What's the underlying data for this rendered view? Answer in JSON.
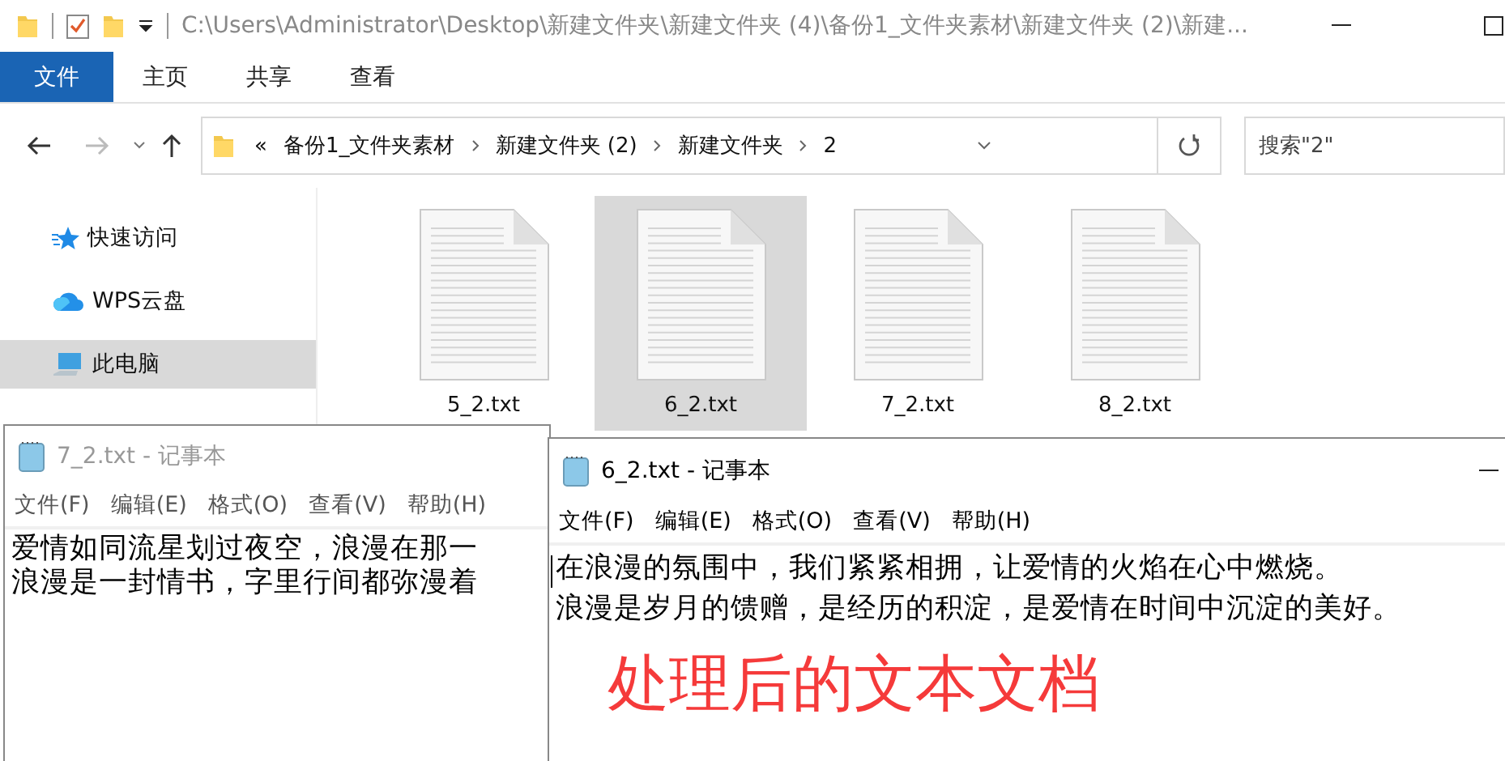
{
  "explorer": {
    "title_path": "C:\\Users\\Administrator\\Desktop\\新建文件夹\\新建文件夹 (4)\\备份1_文件夹素材\\新建文件夹 (2)\\新建...",
    "ribbon_tabs": [
      {
        "label": "文件",
        "selected": true
      },
      {
        "label": "主页",
        "selected": false
      },
      {
        "label": "共享",
        "selected": false
      },
      {
        "label": "查看",
        "selected": false
      }
    ],
    "breadcrumb": {
      "overflow": "«",
      "parts": [
        "备份1_文件夹素材",
        "新建文件夹 (2)",
        "新建文件夹",
        "2"
      ]
    },
    "search": {
      "placeholder": "搜索\"2\""
    },
    "sidebar": {
      "items": [
        {
          "kind": "star",
          "label": "快速访问",
          "selected": false
        },
        {
          "kind": "cloud",
          "label": "WPS云盘",
          "selected": false
        },
        {
          "kind": "pc",
          "label": "此电脑",
          "selected": true
        }
      ]
    },
    "files": [
      {
        "name": "5_2.txt",
        "selected": false
      },
      {
        "name": "6_2.txt",
        "selected": true
      },
      {
        "name": "7_2.txt",
        "selected": false
      },
      {
        "name": "8_2.txt",
        "selected": false
      }
    ]
  },
  "notepads": [
    {
      "title": "7_2.txt - 记事本",
      "active": false,
      "menu": [
        "文件(F)",
        "编辑(E)",
        "格式(O)",
        "查看(V)",
        "帮助(H)"
      ],
      "lines": [
        "爱情如同流星划过夜空，浪漫在那一",
        "浪漫是一封情书，字里行间都弥漫着"
      ]
    },
    {
      "title": "6_2.txt - 记事本",
      "active": true,
      "menu": [
        "文件(F)",
        "编辑(E)",
        "格式(O)",
        "查看(V)",
        "帮助(H)"
      ],
      "lines": [
        "在浪漫的氛围中，我们紧紧相拥，让爱情的火焰在心中燃烧。",
        "浪漫是岁月的馈赠，是经历的积淀，是爱情在时间中沉淀的美好。"
      ]
    }
  ],
  "annotation": "处理后的文本文档"
}
